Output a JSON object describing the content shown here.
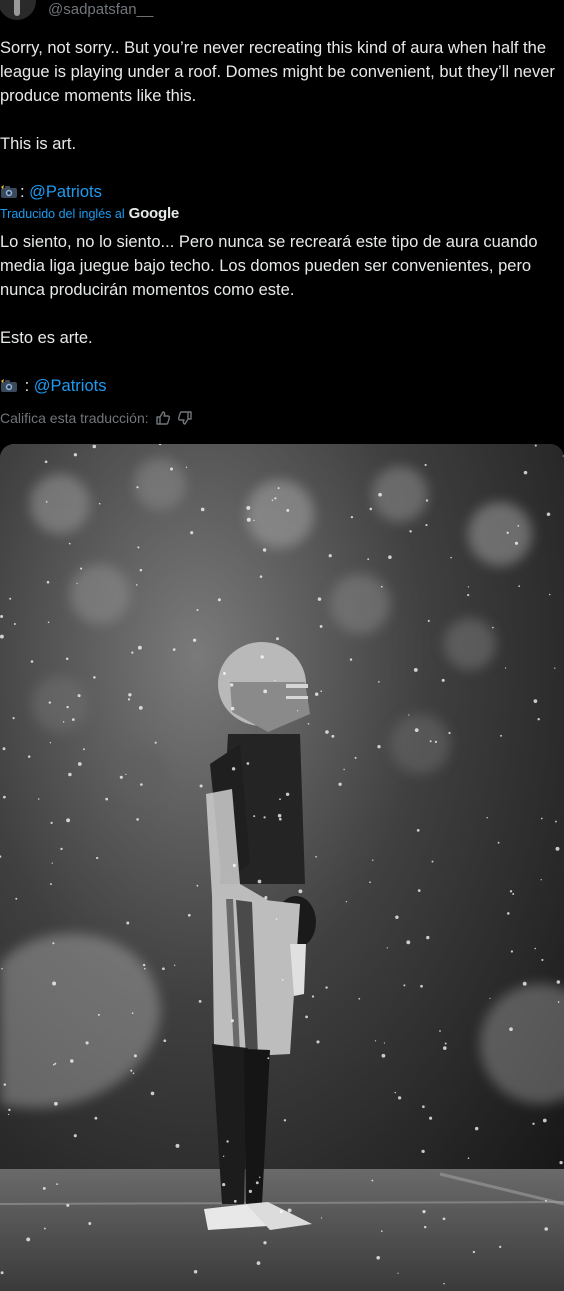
{
  "header": {
    "handle": "@sadpatsfan__"
  },
  "tweet": {
    "text": "Sorry, not sorry.. But you’re never recreating this kind of aura when half the league is playing under a roof. Domes might be convenient, but they’ll never produce moments like this.\n\nThis is art.\n\n",
    "credit_prefix": ": ",
    "credit_mention": "@Patriots"
  },
  "translation": {
    "label": "Traducido del inglés al",
    "brand": "Google",
    "text": "Lo siento, no lo siento... Pero nunca se recreará este tipo de aura cuando media liga juegue bajo techo. Los domos pueden ser convenientes, pero nunca producirán momentos como este.\n\nEsto es arte.\n\n",
    "credit_prefix": " : ",
    "credit_mention": "@Patriots",
    "rate_label": "Califica esta traducción:"
  },
  "colors": {
    "background": "#000000",
    "text": "#e7e9ea",
    "muted": "#71767b",
    "link": "#1d9bf0"
  },
  "icons": [
    "camera-flash-icon",
    "thumbs-up-icon",
    "thumbs-down-icon"
  ]
}
